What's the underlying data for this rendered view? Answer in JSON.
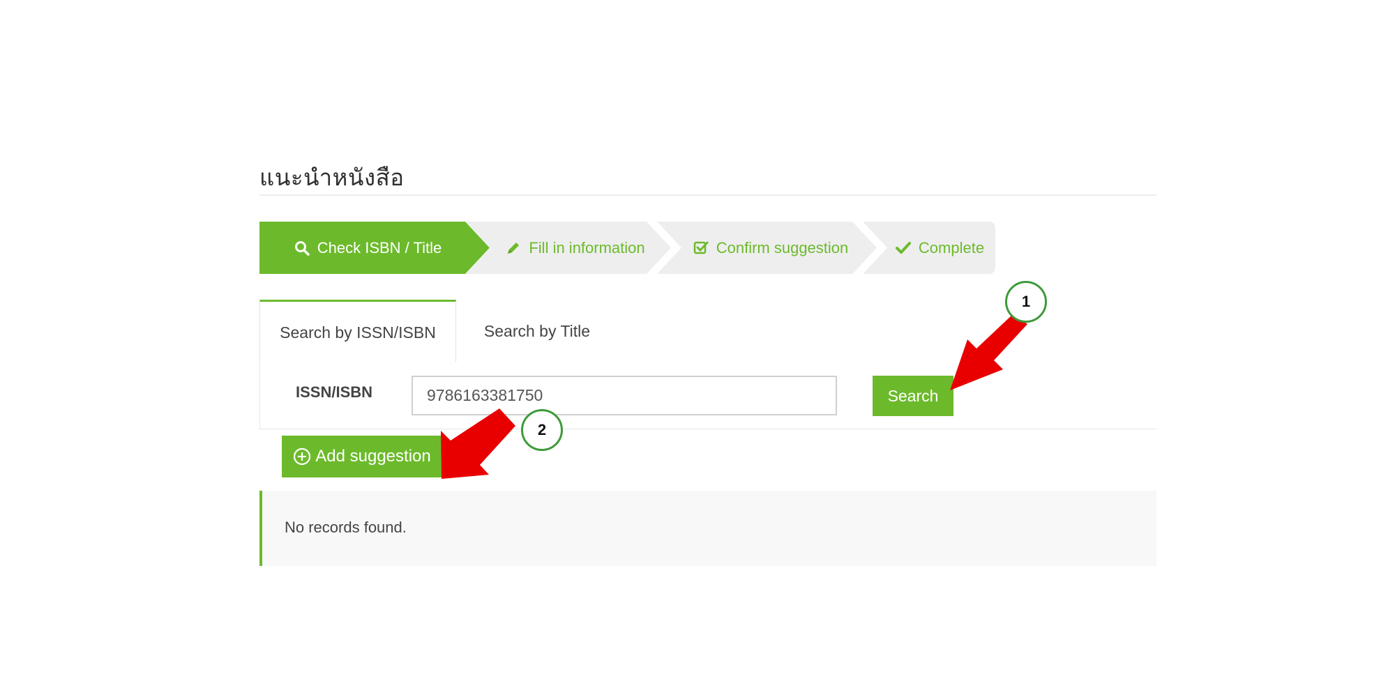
{
  "page": {
    "title": "แนะนำหนังสือ"
  },
  "steps": [
    {
      "label": "Check ISBN / Title",
      "icon": "search-icon",
      "state": "active"
    },
    {
      "label": "Fill in information",
      "icon": "pencil-icon",
      "state": "inactive"
    },
    {
      "label": "Confirm suggestion",
      "icon": "check-square-icon",
      "state": "inactive"
    },
    {
      "label": "Complete",
      "icon": "check-icon",
      "state": "inactive"
    }
  ],
  "tabs": [
    {
      "label": "Search by ISSN/ISBN",
      "active": true
    },
    {
      "label": "Search by Title",
      "active": false
    }
  ],
  "search": {
    "field_label": "ISSN/ISBN",
    "value": "9786163381750",
    "button_label": "Search"
  },
  "actions": {
    "add_label": "Add suggestion",
    "add_icon": "plus-circle-icon"
  },
  "results": {
    "message": "No records found."
  },
  "annotations": {
    "callout_1": "1",
    "callout_2": "2"
  },
  "colors": {
    "accent": "#6cba2b",
    "step_inactive_bg": "#eeeeee",
    "arrow": "#e80000",
    "callout_border": "#3e9a3a"
  }
}
